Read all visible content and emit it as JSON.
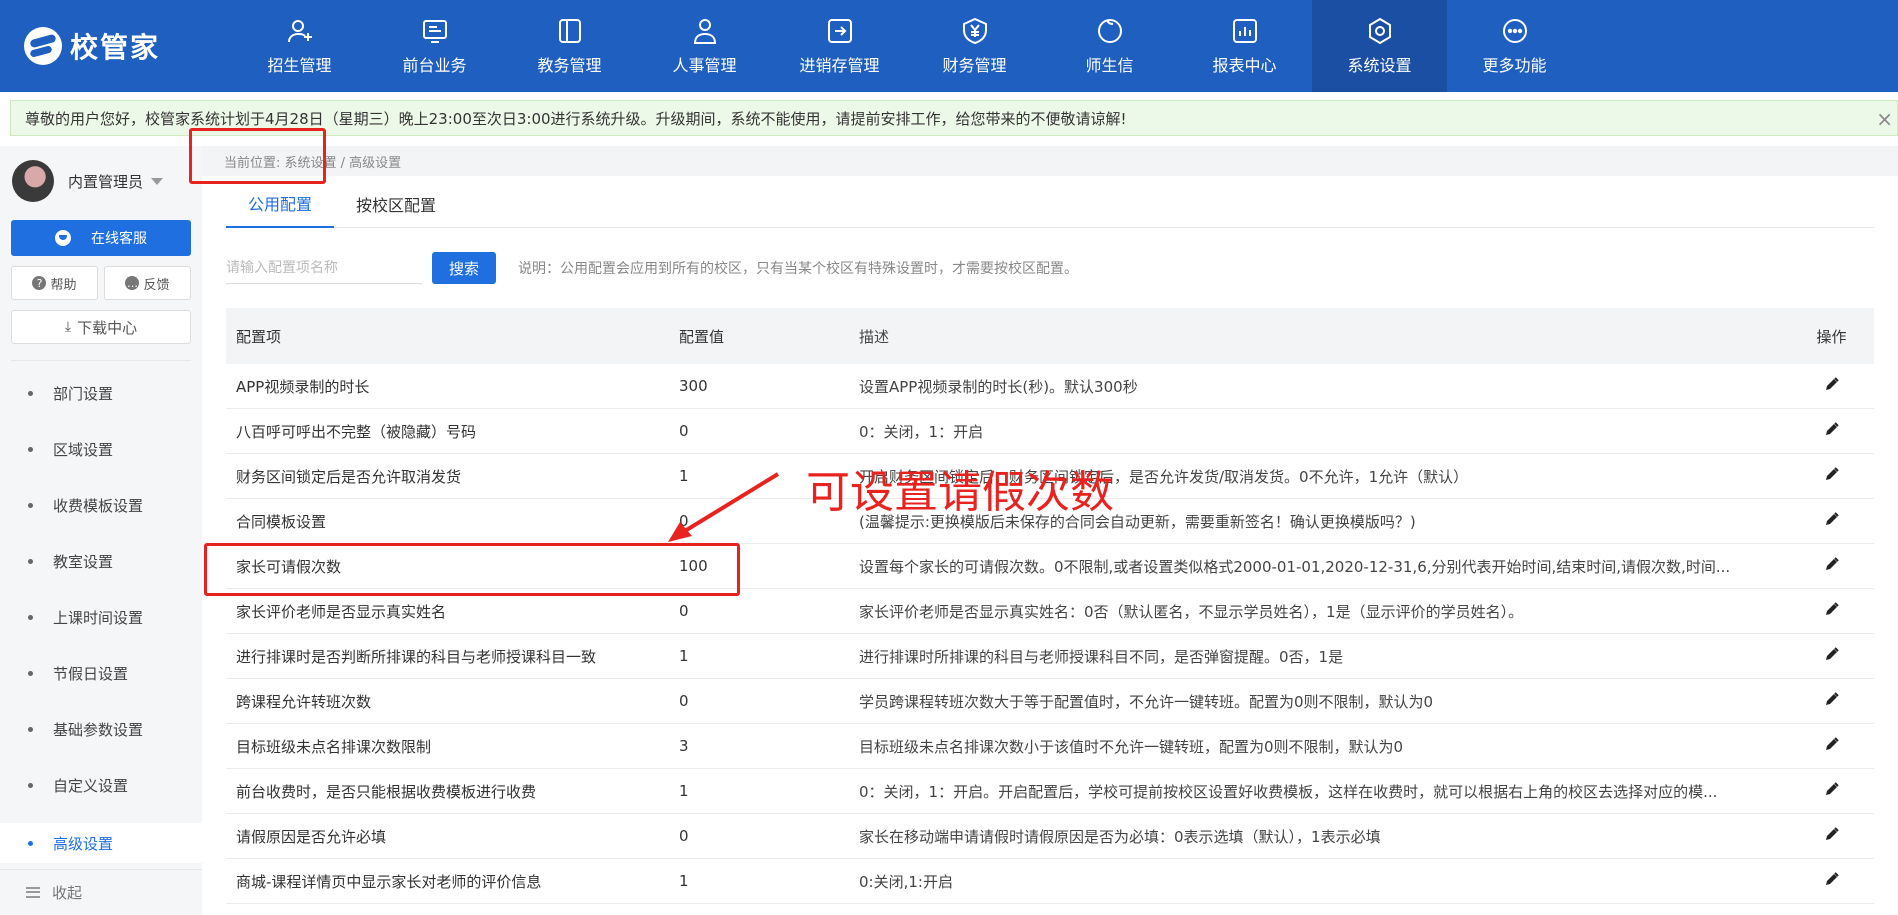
{
  "app": {
    "logo_text": "校管家"
  },
  "nav": [
    {
      "label": "招生管理",
      "icon": "user-plus-icon"
    },
    {
      "label": "前台业务",
      "icon": "monitor-icon"
    },
    {
      "label": "教务管理",
      "icon": "book-icon"
    },
    {
      "label": "人事管理",
      "icon": "person-icon"
    },
    {
      "label": "进销存管理",
      "icon": "box-arrow-icon"
    },
    {
      "label": "财务管理",
      "icon": "yen-shield-icon"
    },
    {
      "label": "师生信",
      "icon": "chat-icon"
    },
    {
      "label": "报表中心",
      "icon": "chart-icon"
    },
    {
      "label": "系统设置",
      "icon": "gear-icon",
      "active": true
    },
    {
      "label": "更多功能",
      "icon": "more-icon"
    }
  ],
  "notice": {
    "text": "尊敬的用户您好，校管家系统计划于4月28日（星期三）晚上23:00至次日3:00进行系统升级。升级期间，系统不能使用，请提前安排工作，给您带来的不便敬请谅解!",
    "close": "×"
  },
  "sidebar": {
    "user_name": "内置管理员",
    "service_label": "在线客服",
    "help_label": "帮助",
    "feedback_label": "反馈",
    "download_label": "下载中心",
    "menu": [
      "部门设置",
      "区域设置",
      "收费模板设置",
      "教室设置",
      "上课时间设置",
      "节假日设置",
      "基础参数设置",
      "自定义设置",
      "高级设置"
    ],
    "active_index": 8,
    "collapse_label": "收起"
  },
  "breadcrumb": "当前位置: 系统设置 / 高级设置",
  "tabs": [
    "公用配置",
    "按校区配置"
  ],
  "search": {
    "placeholder": "请输入配置项名称",
    "button": "搜索",
    "note": "说明：公用配置会应用到所有的校区，只有当某个校区有特殊设置时，才需要按校区配置。"
  },
  "table": {
    "headers": [
      "配置项",
      "配置值",
      "描述",
      "操作"
    ],
    "rows": [
      {
        "name": "APP视频录制的时长",
        "value": "300",
        "desc": "设置APP视频录制的时长(秒)。默认300秒"
      },
      {
        "name": "八百呼可呼出不完整（被隐藏）号码",
        "value": "0",
        "desc": "0：关闭，1：开启"
      },
      {
        "name": "财务区间锁定后是否允许取消发货",
        "value": "1",
        "desc": "开启财务区间锁定后，财务区间锁定后，是否允许发货/取消发货。0不允许，1允许（默认）"
      },
      {
        "name": "合同模板设置",
        "value": "0",
        "desc": "(温馨提示:更换模版后未保存的合同会自动更新，需要重新签名！确认更换模版吗？)"
      },
      {
        "name": "家长可请假次数",
        "value": "100",
        "desc": "设置每个家长的可请假次数。0不限制,或者设置类似格式2000-01-01,2020-12-31,6,分别代表开始时间,结束时间,请假次数,时间..."
      },
      {
        "name": "家长评价老师是否显示真实姓名",
        "value": "0",
        "desc": "家长评价老师是否显示真实姓名：0否（默认匿名，不显示学员姓名），1是（显示评价的学员姓名）。"
      },
      {
        "name": "进行排课时是否判断所排课的科目与老师授课科目一致",
        "value": "1",
        "desc": "进行排课时所排课的科目与老师授课科目不同，是否弹窗提醒。0否，1是"
      },
      {
        "name": "跨课程允许转班次数",
        "value": "0",
        "desc": "学员跨课程转班次数大于等于配置值时，不允许一键转班。配置为0则不限制，默认为0"
      },
      {
        "name": "目标班级未点名排课次数限制",
        "value": "3",
        "desc": "目标班级未点名排课次数小于该值时不允许一键转班，配置为0则不限制，默认为0"
      },
      {
        "name": "前台收费时，是否只能根据收费模板进行收费",
        "value": "1",
        "desc": "0：关闭，1：开启。开启配置后，学校可提前按校区设置好收费模板，这样在收费时，就可以根据右上角的校区去选择对应的模..."
      },
      {
        "name": "请假原因是否允许必填",
        "value": "0",
        "desc": "家长在移动端申请请假时请假原因是否为必填：0表示选填（默认），1表示必填"
      },
      {
        "name": "商城-课程详情页中显示家长对老师的评价信息",
        "value": "1",
        "desc": "0:关闭,1:开启"
      }
    ]
  },
  "annotation": {
    "text": "可设置请假次数",
    "color": "#e8221f"
  }
}
